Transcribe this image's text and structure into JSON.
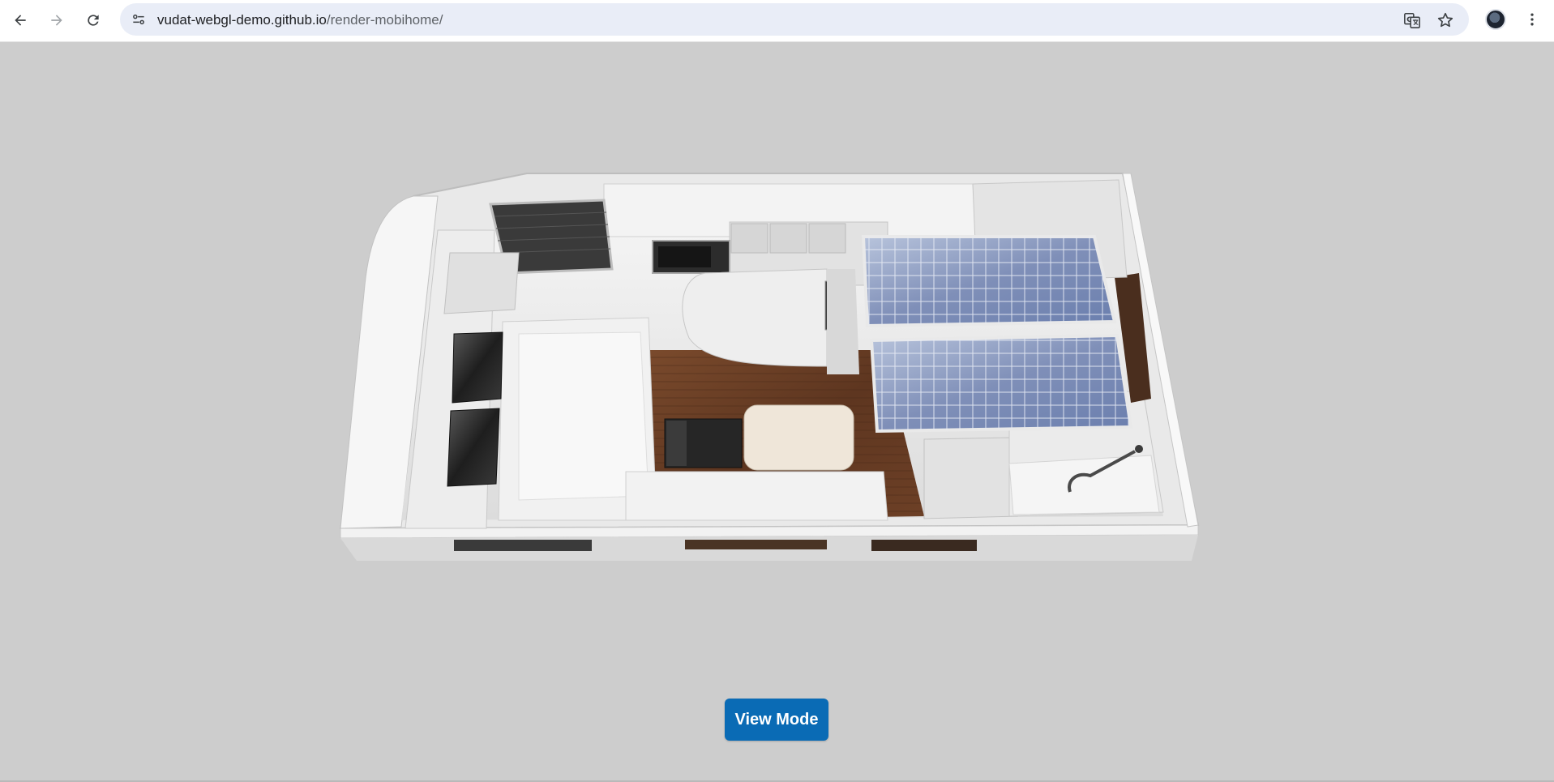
{
  "browser": {
    "url_host": "vudat-webgl-demo.github.io",
    "url_path": "/render-mobihome/",
    "icons": {
      "back": "back-arrow-icon",
      "forward": "forward-arrow-icon",
      "reload": "reload-icon",
      "site_info": "site-info-icon",
      "translate": "translate-icon",
      "bookmark": "star-icon",
      "profile": "avatar",
      "menu": "kebab-menu-icon"
    }
  },
  "viewer": {
    "model": "mobile home 3D render",
    "background_color": "#cdcdcd"
  },
  "controls": {
    "view_mode_label": "View Mode",
    "button_color": "#0a6bb5"
  }
}
